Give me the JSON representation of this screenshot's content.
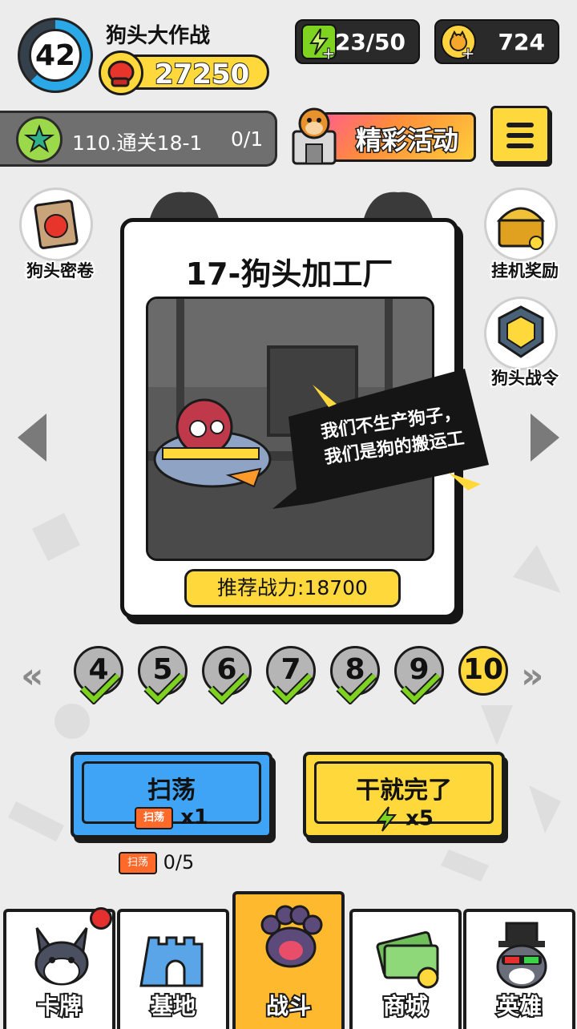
{
  "player": {
    "level": "42",
    "name": "狗头大作战",
    "power": "27250"
  },
  "resources": {
    "energy": "23/50",
    "coins": "724"
  },
  "quest": {
    "text": "110.通关18-1",
    "progress": "0/1"
  },
  "event": {
    "label": "精彩活动"
  },
  "side_left": [
    {
      "label": "狗头密卷"
    }
  ],
  "side_right": [
    {
      "label": "挂机奖励"
    },
    {
      "label": "狗头战令"
    }
  ],
  "stage": {
    "title": "17-狗头加工厂",
    "speech_line1": "我们不生产狗子，",
    "speech_line2": "我们是狗的搬运工",
    "recommended_power": "推荐战力:18700"
  },
  "stage_selector": {
    "prev_label": "«",
    "next_label": "»",
    "stages": [
      {
        "number": "4",
        "cleared": true
      },
      {
        "number": "5",
        "cleared": true
      },
      {
        "number": "6",
        "cleared": true
      },
      {
        "number": "7",
        "cleared": true
      },
      {
        "number": "8",
        "cleared": true
      },
      {
        "number": "9",
        "cleared": true
      },
      {
        "number": "10",
        "cleared": false
      }
    ]
  },
  "actions": {
    "sweep": {
      "label": "扫荡",
      "ticket_text": "扫荡",
      "cost": "x1"
    },
    "fight": {
      "label": "干就完了",
      "cost": "x5"
    }
  },
  "ticket_inventory": {
    "ticket_text": "扫荡",
    "count": "0/5"
  },
  "nav": [
    {
      "label": "卡牌",
      "icon": "husky-icon",
      "active": false,
      "badge": true
    },
    {
      "label": "基地",
      "icon": "castle-icon",
      "active": false,
      "badge": false
    },
    {
      "label": "战斗",
      "icon": "paw-icon",
      "active": true,
      "badge": false
    },
    {
      "label": "商城",
      "icon": "money-icon",
      "active": false,
      "badge": false
    },
    {
      "label": "英雄",
      "icon": "hero-icon",
      "active": false,
      "badge": false
    }
  ],
  "colors": {
    "accent_yellow": "#ffd93b",
    "button_blue": "#3fa4f5",
    "nav_active": "#ffb92e",
    "energy_green": "#7ed321"
  }
}
